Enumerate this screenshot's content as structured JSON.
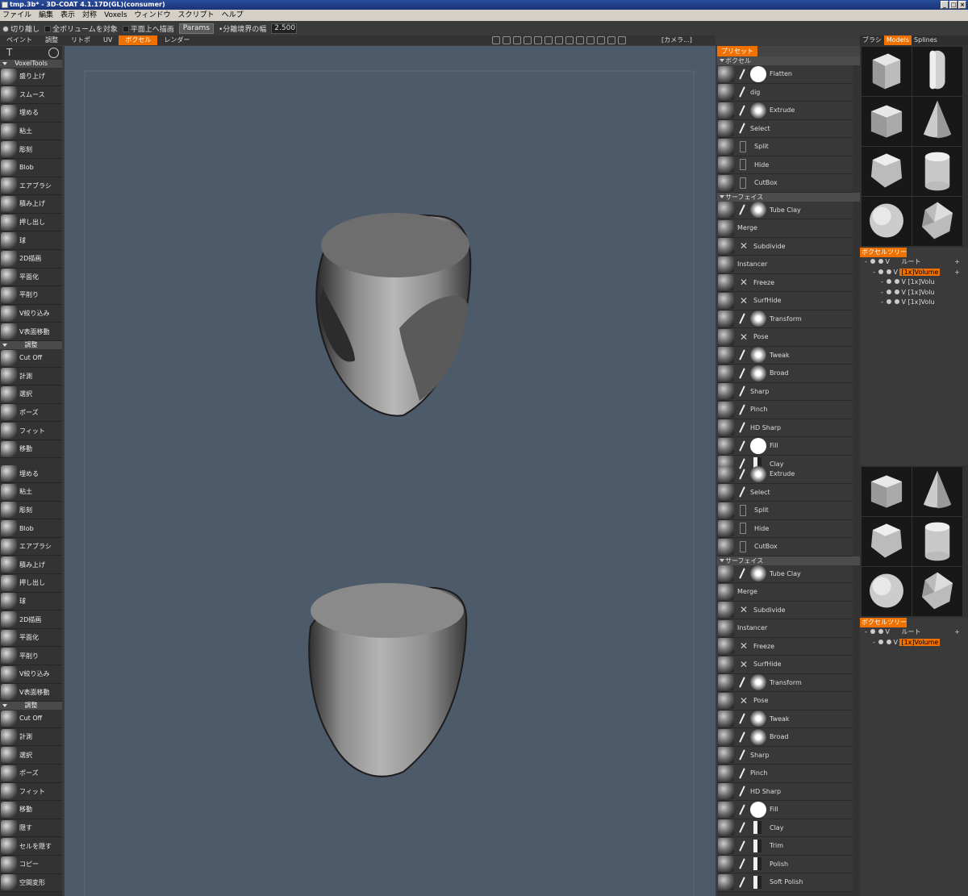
{
  "window": {
    "title": "tmp.3b* - 3D-COAT 4.1.17D(GL)(consumer)"
  },
  "menu": [
    "ファイル",
    "編集",
    "表示",
    "対称",
    "Voxels",
    "ウィンドウ",
    "スクリプト",
    "ヘルプ"
  ],
  "options": {
    "detach": "切り離し",
    "all_volumes": "全ボリュームを対象",
    "draw_on_plane": "平面上へ描画",
    "params": "Params",
    "separation_label": "•分離境界の幅",
    "separation_value": "2.500"
  },
  "rooms": [
    {
      "label": "ペイント",
      "active": false
    },
    {
      "label": "調整",
      "active": false
    },
    {
      "label": "リトポ",
      "active": false
    },
    {
      "label": "UV",
      "active": false
    },
    {
      "label": "ボクセル",
      "active": true
    },
    {
      "label": "レンダー",
      "active": false
    }
  ],
  "camera": "[カメラ...]",
  "left": {
    "voxel_header": "VoxelTools",
    "adjust_header": "調整",
    "voxel_tools": [
      "盛り上げ",
      "スムース",
      "埋める",
      "粘土",
      "彫刻",
      "Blob",
      "エアブラシ",
      "積み上げ",
      "押し出し",
      "球",
      "2D描画",
      "平面化",
      "平削り",
      "V絞り込み",
      "V表面移動"
    ],
    "adjust_tools": [
      "Cut Off",
      "計測",
      "選択",
      "ポーズ",
      "フィット",
      "移動"
    ],
    "voxel_tools2": [
      "埋める",
      "粘土",
      "彫刻",
      "Blob",
      "エアブラシ",
      "積み上げ",
      "押し出し",
      "球",
      "2D描画",
      "平面化",
      "平削り",
      "V絞り込み",
      "V表面移動"
    ],
    "adjust_tools2": [
      "Cut Off",
      "計測",
      "選択",
      "ポーズ",
      "フィット",
      "移動",
      "隠す",
      "セルを隠す",
      "コピー",
      "空間変形"
    ]
  },
  "presets": {
    "header": "プリセット",
    "voxel_section": "ボクセル",
    "surface_section": "サーフェイス",
    "voxel_brushes1": [
      {
        "n": "Flatten",
        "s": "stroke",
        "a": "solid"
      },
      {
        "n": "dig",
        "s": "stroke",
        "a": ""
      },
      {
        "n": "Extrude",
        "s": "stroke",
        "a": "soft"
      },
      {
        "n": "Select",
        "s": "stroke",
        "a": ""
      },
      {
        "n": "Split",
        "s": "box",
        "a": ""
      },
      {
        "n": "Hide",
        "s": "box",
        "a": ""
      },
      {
        "n": "CutBox",
        "s": "box",
        "a": ""
      }
    ],
    "surface_brushes1": [
      {
        "n": "Tube Clay",
        "s": "stroke",
        "a": "soft"
      },
      {
        "n": "Merge",
        "s": "",
        "a": ""
      },
      {
        "n": "Subdivide",
        "s": "x",
        "a": ""
      },
      {
        "n": "Instancer",
        "s": "",
        "a": ""
      },
      {
        "n": "Freeze",
        "s": "x",
        "a": ""
      },
      {
        "n": "SurfHide",
        "s": "x",
        "a": ""
      },
      {
        "n": "Transform",
        "s": "stroke",
        "a": "soft"
      },
      {
        "n": "Pose",
        "s": "x",
        "a": ""
      },
      {
        "n": "Tweak",
        "s": "stroke",
        "a": "soft"
      },
      {
        "n": "Broad",
        "s": "stroke",
        "a": "soft"
      },
      {
        "n": "Sharp",
        "s": "stroke",
        "a": ""
      },
      {
        "n": "Pinch",
        "s": "stroke",
        "a": ""
      },
      {
        "n": "HD Sharp",
        "s": "stroke",
        "a": ""
      },
      {
        "n": "Fill",
        "s": "stroke",
        "a": "solid"
      },
      {
        "n": "Clay",
        "s": "stroke",
        "a": "half"
      }
    ],
    "voxel_brushes2": [
      {
        "n": "Extrude",
        "s": "stroke",
        "a": "soft"
      },
      {
        "n": "Select",
        "s": "stroke",
        "a": ""
      },
      {
        "n": "Split",
        "s": "box",
        "a": ""
      },
      {
        "n": "Hide",
        "s": "box",
        "a": ""
      },
      {
        "n": "CutBox",
        "s": "box",
        "a": ""
      }
    ],
    "surface_brushes2": [
      {
        "n": "Tube Clay",
        "s": "stroke",
        "a": "soft"
      },
      {
        "n": "Merge",
        "s": "",
        "a": ""
      },
      {
        "n": "Subdivide",
        "s": "x",
        "a": ""
      },
      {
        "n": "Instancer",
        "s": "",
        "a": ""
      },
      {
        "n": "Freeze",
        "s": "x",
        "a": ""
      },
      {
        "n": "SurfHide",
        "s": "x",
        "a": ""
      },
      {
        "n": "Transform",
        "s": "stroke",
        "a": "soft"
      },
      {
        "n": "Pose",
        "s": "x",
        "a": ""
      },
      {
        "n": "Tweak",
        "s": "stroke",
        "a": "soft"
      },
      {
        "n": "Broad",
        "s": "stroke",
        "a": "soft"
      },
      {
        "n": "Sharp",
        "s": "stroke",
        "a": ""
      },
      {
        "n": "Pinch",
        "s": "stroke",
        "a": ""
      },
      {
        "n": "HD Sharp",
        "s": "stroke",
        "a": ""
      },
      {
        "n": "Fill",
        "s": "stroke",
        "a": "solid"
      },
      {
        "n": "Clay",
        "s": "stroke",
        "a": "half"
      },
      {
        "n": "Trim",
        "s": "stroke",
        "a": "half"
      },
      {
        "n": "Polish",
        "s": "stroke",
        "a": "half"
      },
      {
        "n": "Soft Polish",
        "s": "stroke",
        "a": "half"
      }
    ]
  },
  "right": {
    "tabs": [
      {
        "label": "ブラシ",
        "active": false
      },
      {
        "label": "Models",
        "active": true
      },
      {
        "label": "Splines",
        "active": false
      }
    ],
    "models1": [
      "cube-rounded",
      "capsule",
      "cube",
      "cone",
      "pentagon-prism",
      "cylinder",
      "sphere",
      "icosahedron"
    ],
    "models2": [
      "cube",
      "cone",
      "pentagon-prism",
      "cylinder",
      "sphere",
      "icosahedron"
    ],
    "tree_title": "ボクセルツリー",
    "tree1": {
      "root": "ルート",
      "selected": "[1x]Volume",
      "children": [
        "[1x]Volu",
        "[1x]Volu",
        "[1x]Volu"
      ]
    },
    "tree2": {
      "root": "ルート",
      "selected": "[1x]Volume"
    }
  },
  "colors": {
    "accent": "#f07000",
    "viewport": "#4d5a6a"
  }
}
